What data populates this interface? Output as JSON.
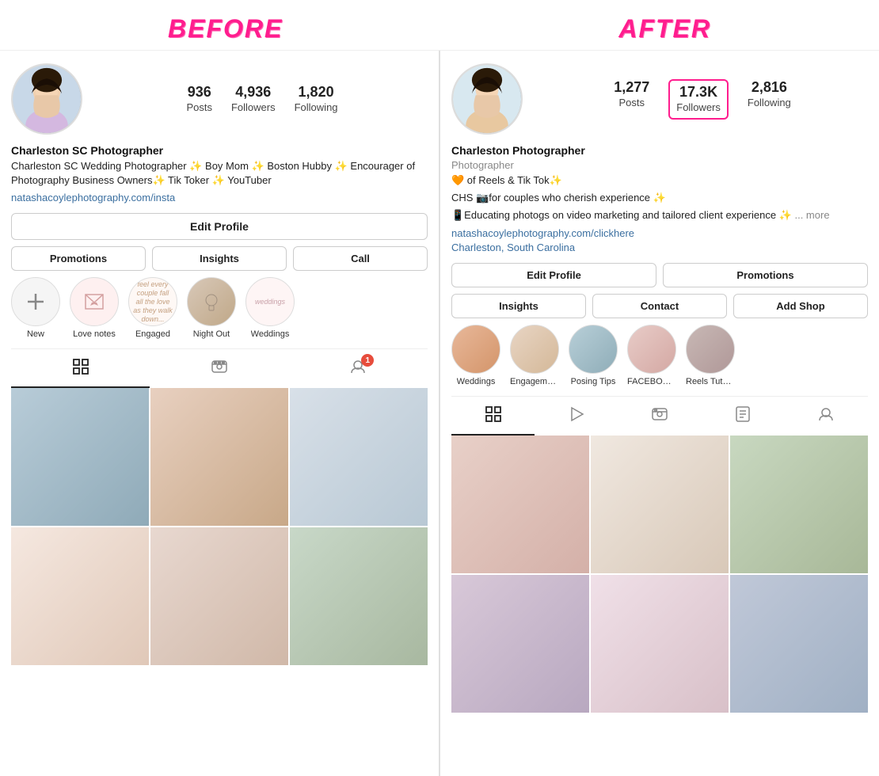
{
  "before": {
    "label": "BEFORE",
    "stats": {
      "posts": {
        "value": "936",
        "label": "Posts"
      },
      "followers": {
        "value": "4,936",
        "label": "Followers"
      },
      "following": {
        "value": "1,820",
        "label": "Following"
      }
    },
    "bio": {
      "name": "Charleston SC Photographer",
      "text": "Charleston SC Wedding Photographer ✨ Boy Mom ✨ Boston Hubby ✨ Encourager of Photography Business Owners✨ Tik Toker ✨ YouTuber",
      "link": "natashacoylephotography.com/insta"
    },
    "buttons": {
      "edit_profile": "Edit Profile",
      "promotions": "Promotions",
      "insights": "Insights",
      "call": "Call"
    },
    "highlights": [
      {
        "label": "New",
        "type": "add"
      },
      {
        "label": "Love notes",
        "type": "love"
      },
      {
        "label": "Engaged",
        "type": "engaged"
      },
      {
        "label": "Night Out",
        "type": "nightout"
      },
      {
        "label": "Weddings",
        "type": "weddings-b"
      }
    ]
  },
  "after": {
    "label": "AFTER",
    "stats": {
      "posts": {
        "value": "1,277",
        "label": "Posts"
      },
      "followers": {
        "value": "17.3K",
        "label": "Followers"
      },
      "following": {
        "value": "2,816",
        "label": "Following"
      }
    },
    "bio": {
      "name": "Charleston Photographer",
      "category": "Photographer",
      "line1": "🧡 of Reels & Tik Tok✨",
      "line2": "CHS 📷for couples who cherish experience ✨",
      "line3": "📱Educating photogs on video marketing and tailored client experience ✨",
      "more": "... more",
      "link": "natashacoylephotography.com/clickhere",
      "location": "Charleston, South Carolina"
    },
    "buttons": {
      "edit_profile": "Edit Profile",
      "promotions": "Promotions",
      "insights": "Insights",
      "contact": "Contact",
      "add_shop": "Add Shop"
    },
    "highlights": [
      {
        "label": "Weddings",
        "type": "weddings"
      },
      {
        "label": "Engagements",
        "type": "engagements"
      },
      {
        "label": "Posing Tips",
        "type": "posing"
      },
      {
        "label": "FACEBOOK...",
        "type": "facebook"
      },
      {
        "label": "Reels Tutori...",
        "type": "reels"
      }
    ]
  }
}
